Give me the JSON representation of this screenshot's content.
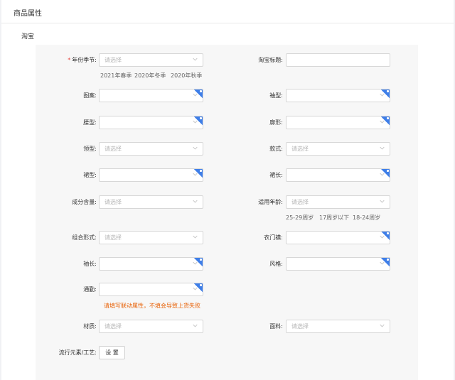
{
  "header": {
    "title": "商品属性"
  },
  "platform": "淘宝",
  "placeholder": "请选择",
  "fields": {
    "year_season": {
      "label": "年份季节:",
      "required_mark": "*",
      "options": [
        "2021年春季",
        "2020年冬季",
        "2020年秋季"
      ]
    },
    "taobao_title": {
      "label": "淘宝标题:"
    },
    "pattern": {
      "label": "图案:"
    },
    "sleeve_type": {
      "label": "袖型:"
    },
    "waist_type": {
      "label": "腰型:"
    },
    "silhouette": {
      "label": "廓形:"
    },
    "collar_type": {
      "label": "领型:"
    },
    "style_type": {
      "label": "款式:"
    },
    "skirt_type": {
      "label": "裙型:"
    },
    "skirt_length": {
      "label": "裙长:"
    },
    "composition": {
      "label": "成分含量:"
    },
    "age_range": {
      "label": "适用年龄:",
      "options": [
        "25-29周岁",
        "17周岁以下",
        "18-24周岁"
      ]
    },
    "combination": {
      "label": "组合形式:"
    },
    "placket": {
      "label": "衣门襟:"
    },
    "sleeve_length": {
      "label": "袖长:"
    },
    "style": {
      "label": "风格:"
    },
    "commute": {
      "label": "通勤:",
      "warning": "请填写联动属性，不填会导致上货失败"
    },
    "material": {
      "label": "材质:"
    },
    "fabric": {
      "label": "面料:"
    },
    "trend_elements": {
      "label": "流行元素/工艺:",
      "button": "设 置"
    }
  },
  "colors": {
    "badge": "#3e7ee8",
    "required": "#e6403a",
    "warning": "#e8630a"
  },
  "icons": {
    "dropdown": "chevron-down-icon",
    "badge": "linked-attribute-badge-icon"
  }
}
